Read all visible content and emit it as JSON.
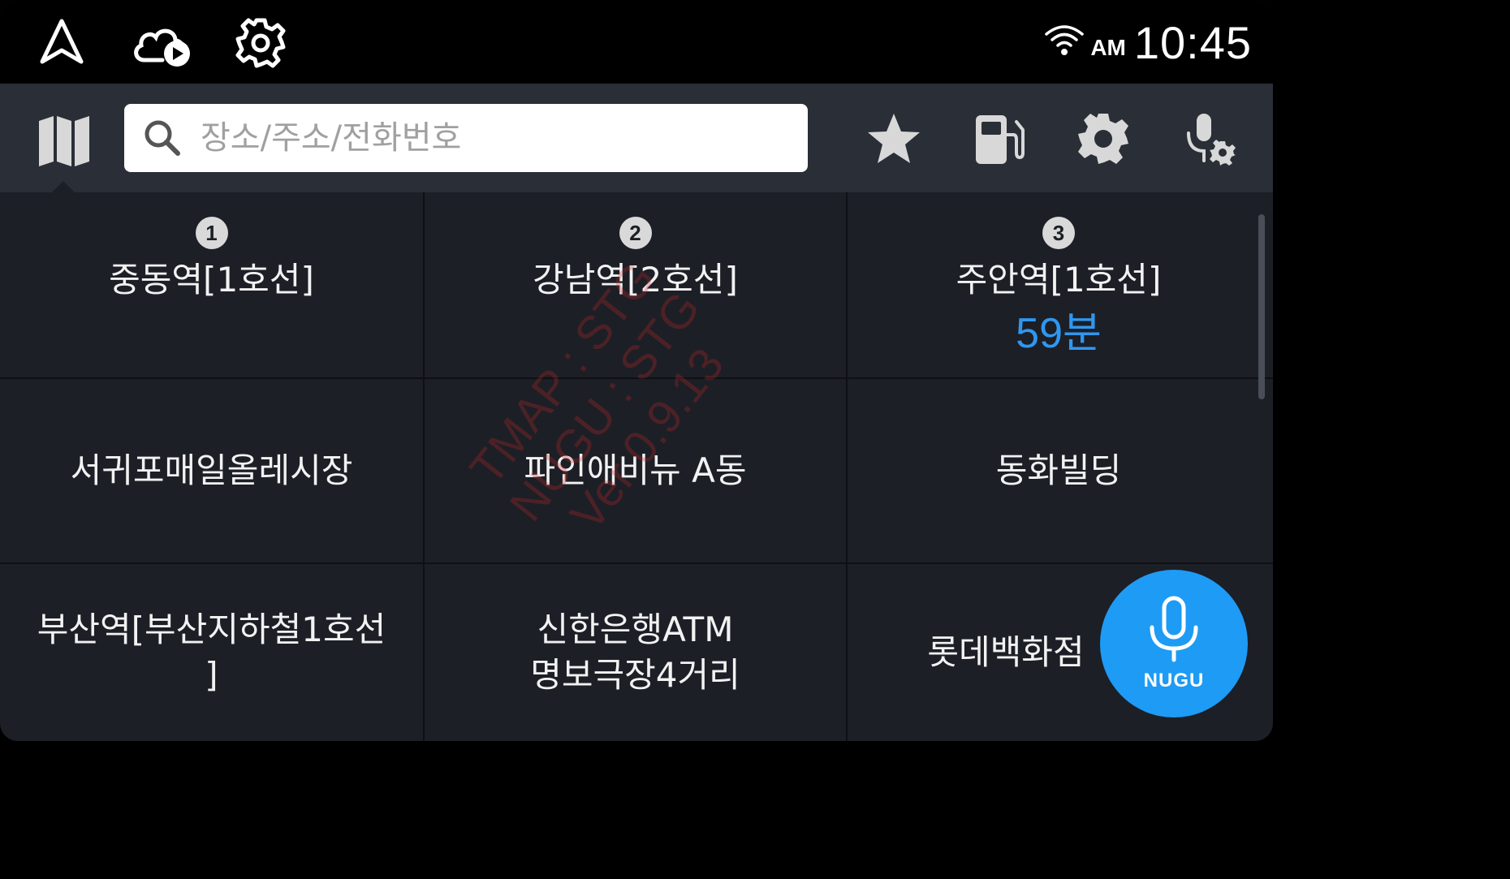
{
  "status_bar": {
    "ampm": "AM",
    "time": "10:45",
    "icons": [
      "navigation-arrow-icon",
      "cloud-play-icon",
      "settings-gear-icon",
      "wifi-icon"
    ]
  },
  "toolbar": {
    "search_placeholder": "장소/주소/전화번호",
    "icons": [
      "map-icon",
      "search-icon",
      "star-icon",
      "fuel-icon",
      "settings-icon",
      "voice-settings-icon"
    ]
  },
  "favorites": [
    {
      "rank": "1",
      "name": "중동역[1호선]",
      "eta": ""
    },
    {
      "rank": "2",
      "name": "강남역[2호선]",
      "eta": ""
    },
    {
      "rank": "3",
      "name": "주안역[1호선]",
      "eta": "59분"
    }
  ],
  "places": [
    {
      "name": "서귀포매일올레시장"
    },
    {
      "name": "파인애비뉴 A동"
    },
    {
      "name": "동화빌딩"
    },
    {
      "name": "부산역[부산지하철1호선",
      "name2": "]"
    },
    {
      "name": "신한은행ATM",
      "name2": "명보극장4거리"
    },
    {
      "name": "롯데백화점"
    }
  ],
  "watermark": {
    "line1": "TMAP : STG",
    "line2": "NUGU : STG",
    "line3": "Ver 0.9.13"
  },
  "nugu": {
    "label": "NUGU"
  },
  "colors": {
    "accent": "#1e9bf5",
    "eta": "#2f97f0",
    "background": "#1c1f26",
    "toolbar": "#2a2e37"
  }
}
